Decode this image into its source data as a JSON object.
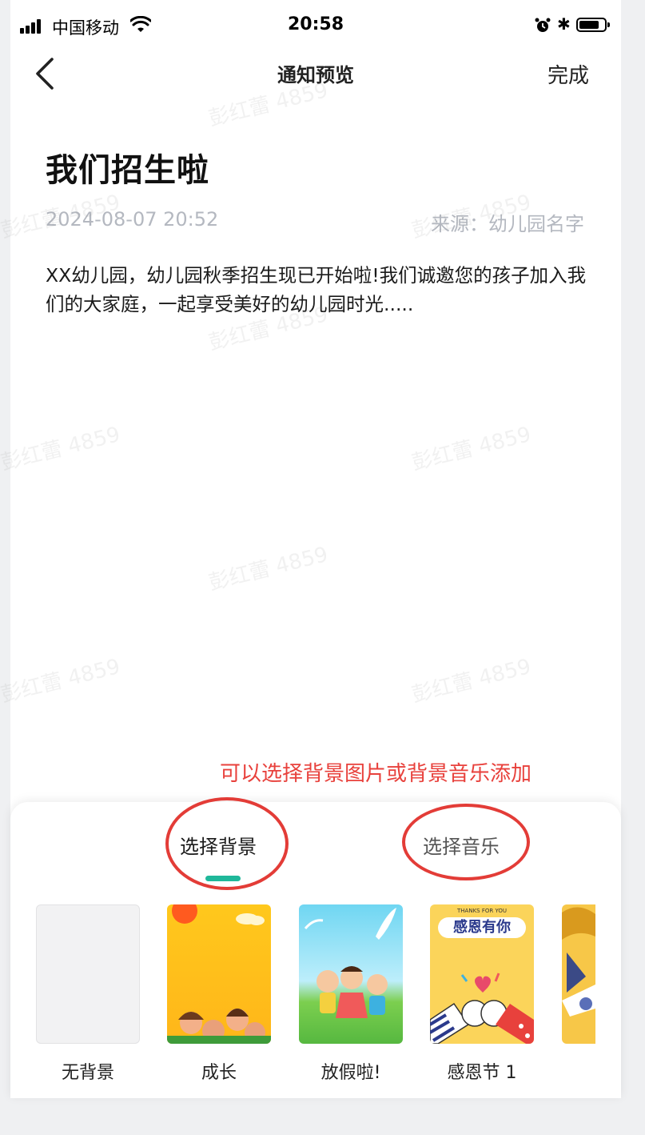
{
  "status_bar": {
    "carrier": "中国移动",
    "time": "20:58"
  },
  "nav": {
    "title": "通知预览",
    "done": "完成"
  },
  "article": {
    "title": "我们招生啦",
    "date": "2024-08-07 20:52",
    "source": "来源：幼儿园名字",
    "body": "XX幼儿园，幼儿园秋季招生现已开始啦!我们诚邀您的孩子加入我们的大家庭，一起享受美好的幼儿园时光....."
  },
  "watermark": "彭红蕾 4859",
  "annotation": "可以选择背景图片或背景音乐添加",
  "sheet": {
    "tabs": [
      {
        "label": "选择背景",
        "active": true
      },
      {
        "label": "选择音乐",
        "active": false
      }
    ],
    "backgrounds": [
      {
        "label": "无背景"
      },
      {
        "label": "成长"
      },
      {
        "label": "放假啦!"
      },
      {
        "label": "感恩节 1",
        "image_text": "感恩有你",
        "image_caption": "THANKS FOR YOU"
      },
      {
        "label": ""
      }
    ]
  },
  "colors": {
    "accent": "#1fb89a",
    "annotation": "#e8413c",
    "muted_text": "#b4b8c0"
  }
}
